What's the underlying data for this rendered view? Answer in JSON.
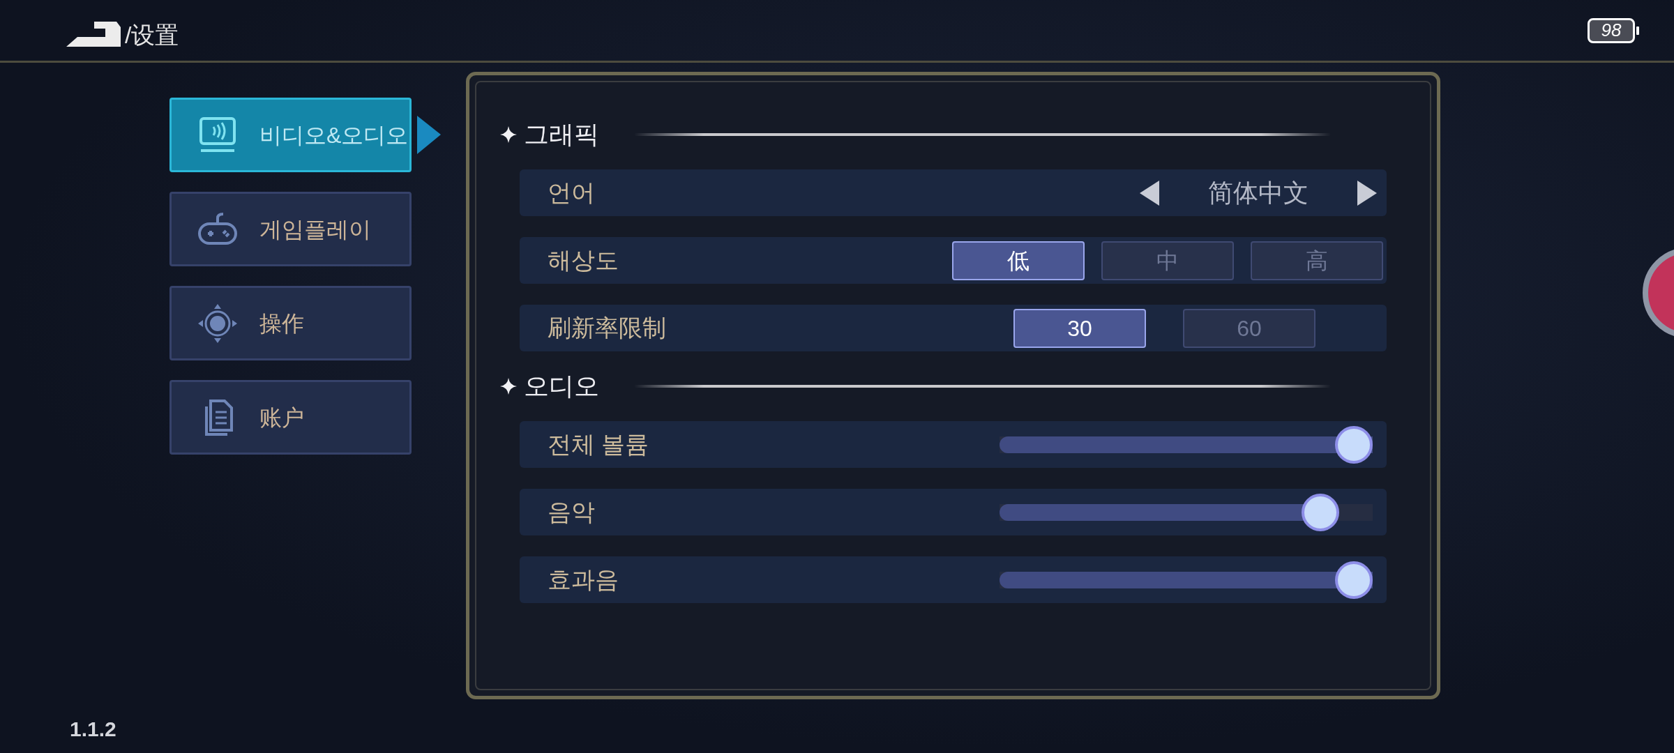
{
  "header": {
    "title": "/设置"
  },
  "battery": {
    "label": "98"
  },
  "sidebar": {
    "items": [
      {
        "label": "비디오&오디오",
        "selected": true,
        "kind": "display"
      },
      {
        "label": "게임플레이",
        "selected": false,
        "kind": "gamepad"
      },
      {
        "label": "操作",
        "selected": false,
        "kind": "joystick"
      },
      {
        "label": "账户",
        "selected": false,
        "kind": "document"
      }
    ]
  },
  "sections": [
    {
      "title": "그래픽",
      "rows": [
        {
          "kind": "selector",
          "label": "언어",
          "value": "简体中文"
        },
        {
          "kind": "options",
          "label": "해상도",
          "options": [
            {
              "label": "低",
              "selected": true
            },
            {
              "label": "中",
              "selected": false
            },
            {
              "label": "高",
              "selected": false
            }
          ]
        },
        {
          "kind": "options",
          "label": "刷新率限制",
          "options": [
            {
              "label": "30",
              "selected": true
            },
            {
              "label": "60",
              "selected": false
            }
          ]
        }
      ]
    },
    {
      "title": "오디오",
      "rows": [
        {
          "kind": "slider",
          "label": "전체 볼륨",
          "level": 1
        },
        {
          "kind": "slider",
          "label": "음악",
          "level": 0.9
        },
        {
          "kind": "slider",
          "label": "효과음",
          "level": 1
        }
      ]
    }
  ],
  "version": "1.1.2"
}
